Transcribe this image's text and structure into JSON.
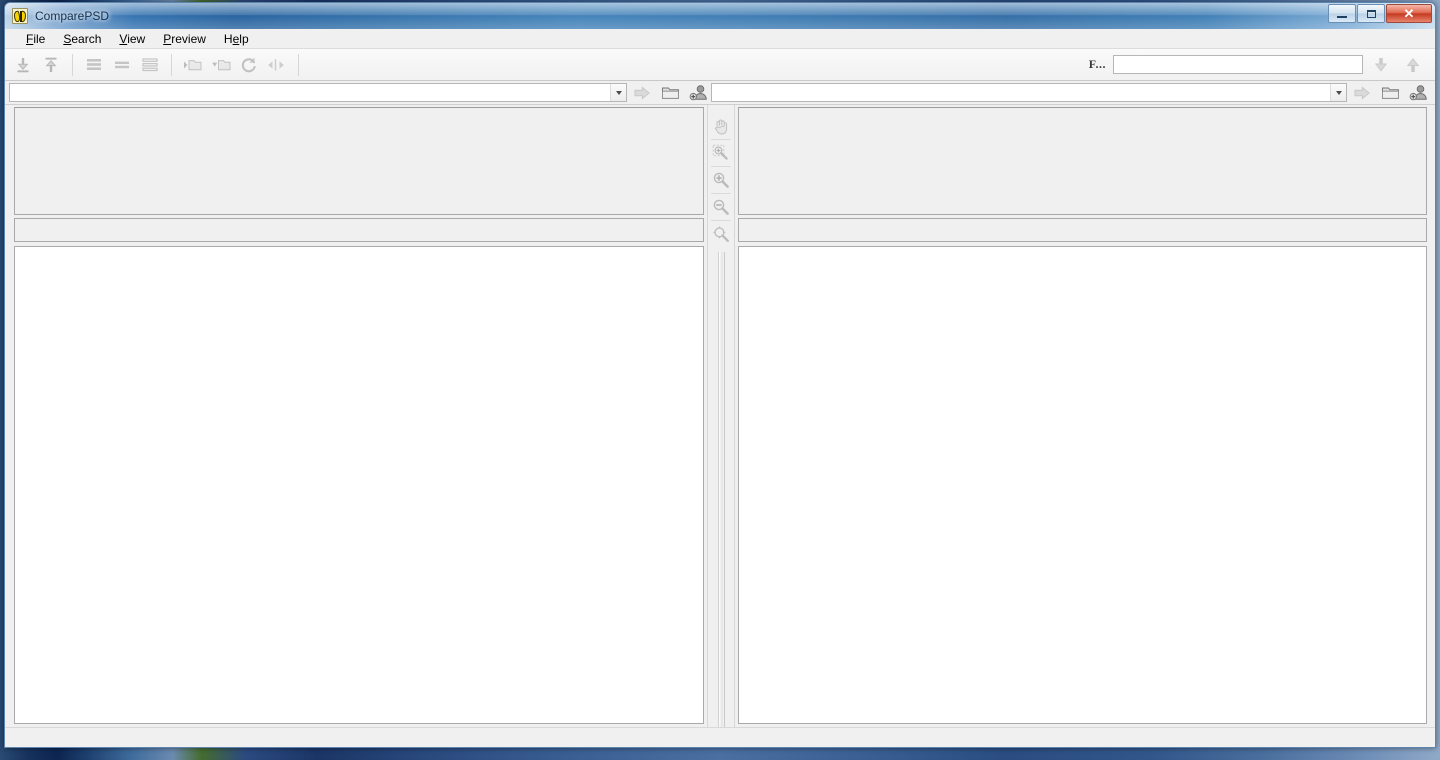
{
  "window": {
    "title": "ComparePSD",
    "app_icon": "butterfly-icon",
    "minimize_label": "Minimize",
    "maximize_label": "Maximize",
    "close_label": "✕"
  },
  "menubar": {
    "items": [
      {
        "label": "File",
        "mnemonic": "F"
      },
      {
        "label": "Search",
        "mnemonic": "S"
      },
      {
        "label": "View",
        "mnemonic": "V"
      },
      {
        "label": "Preview",
        "mnemonic": "P"
      },
      {
        "label": "Help",
        "mnemonic": "H"
      }
    ]
  },
  "toolbar": {
    "groups": [
      {
        "buttons": [
          {
            "name": "move-down-button",
            "icon": "arrow-down-to-line-icon",
            "tooltip": "Move Down",
            "enabled": false
          },
          {
            "name": "move-up-button",
            "icon": "arrow-up-to-line-icon",
            "tooltip": "Move Up",
            "enabled": false
          }
        ]
      },
      {
        "buttons": [
          {
            "name": "view-details-button",
            "icon": "list-details-icon",
            "tooltip": "Details View",
            "enabled": false
          },
          {
            "name": "view-list-button",
            "icon": "list-compact-icon",
            "tooltip": "List View",
            "enabled": false
          },
          {
            "name": "view-report-button",
            "icon": "list-report-icon",
            "tooltip": "Report View",
            "enabled": false
          }
        ]
      },
      {
        "buttons": [
          {
            "name": "expand-folder-button",
            "icon": "folder-expand-icon",
            "tooltip": "Expand Folder",
            "enabled": false
          },
          {
            "name": "collapse-folder-button",
            "icon": "folder-collapse-icon",
            "tooltip": "Collapse Folder",
            "enabled": false
          },
          {
            "name": "refresh-button",
            "icon": "refresh-icon",
            "tooltip": "Refresh",
            "enabled": false
          },
          {
            "name": "swap-panes-button",
            "icon": "swap-arrows-icon",
            "tooltip": "Swap Panes",
            "enabled": false
          }
        ]
      }
    ],
    "find": {
      "label": "F...",
      "value": "",
      "placeholder": "",
      "find_next": {
        "name": "find-next-button",
        "icon": "arrow-down-icon",
        "enabled": false
      },
      "find_prev": {
        "name": "find-previous-button",
        "icon": "arrow-up-icon",
        "enabled": false
      }
    }
  },
  "path_bars": {
    "left": {
      "combo_value": "",
      "combo_placeholder": "",
      "go_button": {
        "icon": "arrow-right-icon",
        "tooltip": "Go",
        "enabled": false
      },
      "browse_button": {
        "icon": "folder-icon",
        "tooltip": "Browse Folder",
        "enabled": true
      },
      "profile_button": {
        "icon": "user-add-icon",
        "tooltip": "Add Profile",
        "enabled": true
      }
    },
    "right": {
      "combo_value": "",
      "combo_placeholder": "",
      "go_button": {
        "icon": "arrow-right-icon",
        "tooltip": "Go",
        "enabled": false
      },
      "browse_button": {
        "icon": "folder-icon",
        "tooltip": "Browse Folder",
        "enabled": true
      },
      "profile_button": {
        "icon": "user-add-icon",
        "tooltip": "Add Profile",
        "enabled": true
      }
    }
  },
  "tool_strip": {
    "buttons": [
      {
        "name": "pan-tool-button",
        "icon": "hand-icon",
        "tooltip": "Pan",
        "enabled": false
      },
      {
        "name": "zoom-selection-button",
        "icon": "zoom-selection-icon",
        "tooltip": "Zoom Selection",
        "enabled": false
      },
      {
        "name": "zoom-in-button",
        "icon": "zoom-in-icon",
        "tooltip": "Zoom In",
        "enabled": false
      },
      {
        "name": "zoom-out-button",
        "icon": "zoom-out-icon",
        "tooltip": "Zoom Out",
        "enabled": false
      },
      {
        "name": "zoom-fit-button",
        "icon": "zoom-fit-icon",
        "tooltip": "Fit to Window",
        "enabled": false
      }
    ]
  },
  "panes": {
    "left": {
      "preview_content": "",
      "info_content": "",
      "list_content": ""
    },
    "right": {
      "preview_content": "",
      "info_content": "",
      "list_content": ""
    }
  },
  "statusbar": {
    "text": ""
  },
  "colors": {
    "titlebar_accent": "#2f6fae",
    "close_button": "#c53a22",
    "window_face": "#f0f0f0",
    "list_background": "#ffffff",
    "border": "#a9a9a9"
  }
}
